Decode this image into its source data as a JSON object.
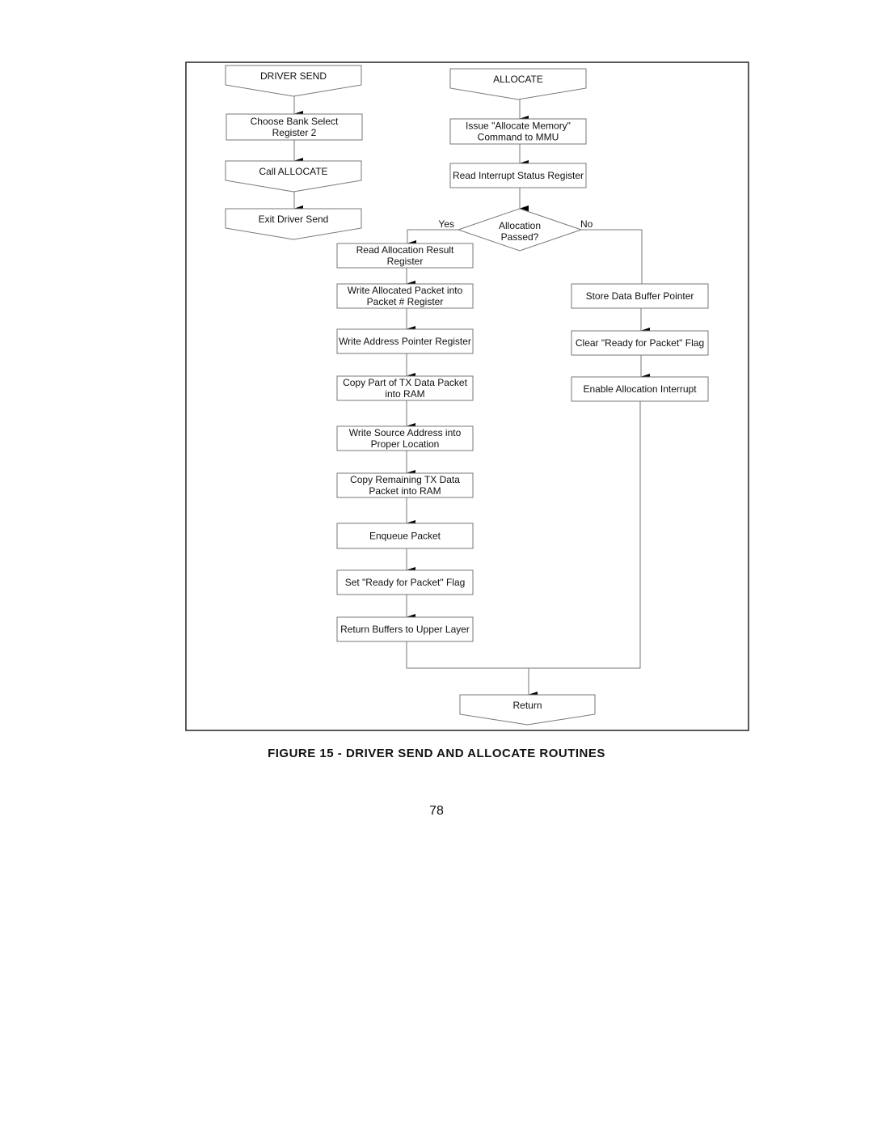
{
  "figure": {
    "caption": "FIGURE 15 - DRIVER SEND AND ALLOCATE ROUTINES",
    "page_number": "78"
  },
  "driver_send": {
    "start": "DRIVER SEND",
    "steps": [
      [
        "Choose Bank Select",
        "Register 2"
      ],
      [
        "Call ALLOCATE"
      ]
    ],
    "end": "Exit Driver Send"
  },
  "allocate": {
    "start": "ALLOCATE",
    "steps": [
      [
        "Issue \"Allocate Memory\"",
        "Command to MMU"
      ],
      [
        "Read Interrupt Status Register"
      ]
    ],
    "decision": [
      "Allocation",
      "Passed?"
    ],
    "yes_label": "Yes",
    "no_label": "No",
    "yes_branch": [
      [
        "Read Allocation Result",
        "Register"
      ],
      [
        "Write Allocated Packet  into",
        "Packet # Register"
      ],
      [
        "Write Address Pointer Register"
      ],
      [
        "Copy Part of TX Data Packet",
        "into RAM"
      ],
      [
        "Write Source Address into",
        "Proper Location"
      ],
      [
        "Copy Remaining TX Data",
        "Packet into RAM"
      ],
      [
        "Enqueue Packet"
      ],
      [
        "Set \"Ready for Packet\" Flag"
      ],
      [
        "Return Buffers to Upper Layer"
      ]
    ],
    "no_branch": [
      [
        "Store Data Buffer Pointer"
      ],
      [
        "Clear \"Ready for Packet\" Flag"
      ],
      [
        "Enable Allocation Interrupt"
      ]
    ],
    "end": "Return"
  }
}
